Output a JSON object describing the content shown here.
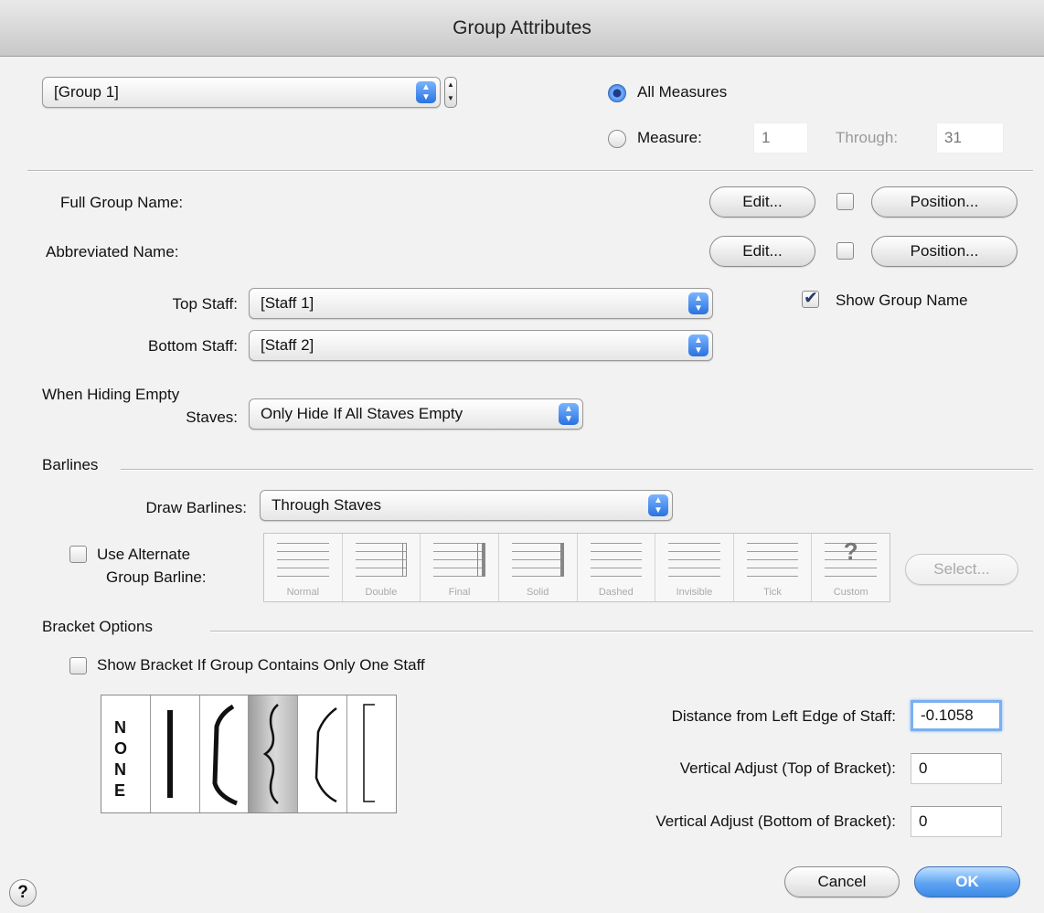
{
  "window": {
    "title": "Group Attributes"
  },
  "group_select": {
    "value": "[Group 1]"
  },
  "measures": {
    "all_label": "All Measures",
    "all_selected": true,
    "measure_label": "Measure:",
    "measure_value": "1",
    "through_label": "Through:",
    "through_value": "31"
  },
  "full_group_name": {
    "label": "Full Group Name:",
    "edit": "Edit...",
    "position": "Position..."
  },
  "abbreviated_name": {
    "label": "Abbreviated Name:",
    "edit": "Edit...",
    "position": "Position..."
  },
  "top_staff": {
    "label": "Top Staff:",
    "value": "[Staff 1]"
  },
  "bottom_staff": {
    "label": "Bottom Staff:",
    "value": "[Staff 2]"
  },
  "show_group_name": {
    "label": "Show Group Name",
    "checked": true
  },
  "hiding": {
    "label_line1": "When Hiding Empty",
    "label_line2": "Staves:",
    "value": "Only Hide If All Staves Empty"
  },
  "barlines": {
    "section": "Barlines",
    "draw_label": "Draw Barlines:",
    "draw_value": "Through Staves",
    "alternate_line1": "Use Alternate",
    "alternate_line2": "Group Barline:",
    "styles": [
      "Normal",
      "Double",
      "Final",
      "Solid",
      "Dashed",
      "Invisible",
      "Tick",
      "Custom"
    ],
    "select_button": "Select..."
  },
  "bracket": {
    "section": "Bracket Options",
    "single_staff_label": "Show Bracket If Group Contains Only One Staff",
    "none_letters": "NONE",
    "distance_label": "Distance from Left Edge of Staff:",
    "distance_value": "-0.1058",
    "vtop_label": "Vertical Adjust (Top of Bracket):",
    "vtop_value": "0",
    "vbottom_label": "Vertical Adjust (Bottom of Bracket):",
    "vbottom_value": "0"
  },
  "buttons": {
    "cancel": "Cancel",
    "ok": "OK",
    "help": "?"
  }
}
